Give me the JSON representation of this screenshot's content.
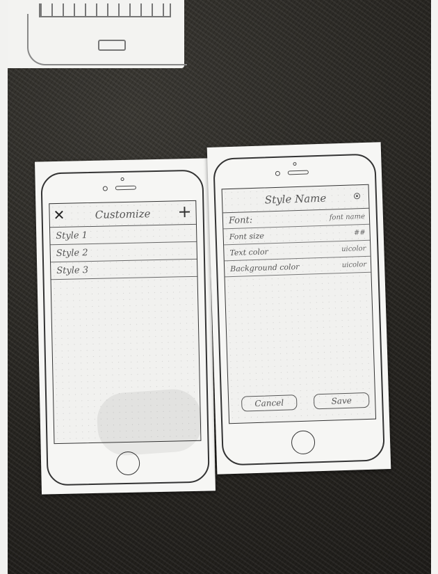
{
  "list_screen": {
    "title": "Customize",
    "close_icon": "close-x-icon",
    "add_icon": "plus-icon",
    "styles": [
      {
        "label": "Style 1"
      },
      {
        "label": "Style 2"
      },
      {
        "label": "Style 3"
      }
    ]
  },
  "detail_screen": {
    "title": "Style Name",
    "info_icon": "info-circle-icon",
    "fields": [
      {
        "label": "Font:",
        "value": "font name"
      },
      {
        "label": "Font size",
        "value": "##"
      },
      {
        "label": "Text color",
        "value": "uicolor"
      },
      {
        "label": "Background color",
        "value": "uicolor"
      }
    ],
    "cancel_label": "Cancel",
    "save_label": "Save"
  },
  "colors": {
    "paper": "#f6f6f4",
    "ink": "#555555",
    "background": "#2b2925"
  }
}
